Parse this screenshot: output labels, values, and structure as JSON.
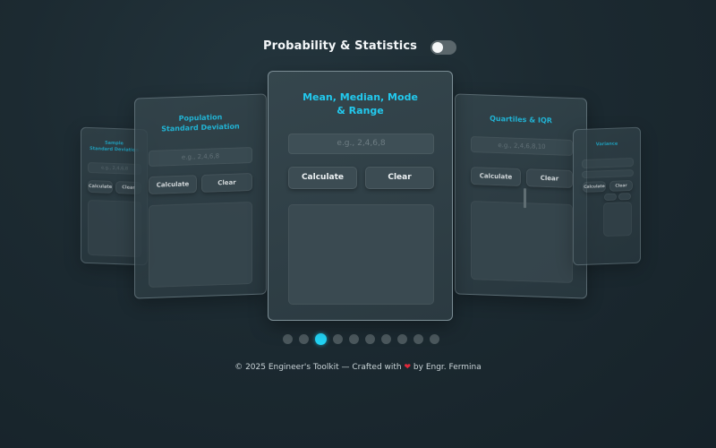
{
  "app_title": "Probability & Statistics",
  "theme_toggle": {
    "state": "off"
  },
  "cards": {
    "sample": {
      "title_line1": "Sample",
      "title_line2": "Standard Deviation",
      "placeholder": "e.g., 2,4,6,8",
      "calculate": "Calculate",
      "clear": "Clear"
    },
    "population": {
      "title_line1": "Population",
      "title_line2": "Standard Deviation",
      "placeholder": "e.g., 2,4,6,8",
      "calculate": "Calculate",
      "clear": "Clear"
    },
    "mean": {
      "title_line1": "Mean, Median, Mode",
      "title_line2": "& Range",
      "placeholder": "e.g., 2,4,6,8",
      "calculate": "Calculate",
      "clear": "Clear"
    },
    "quartiles": {
      "title": "Quartiles & IQR",
      "placeholder": "e.g., 2,4,6,8,10",
      "calculate": "Calculate",
      "clear": "Clear"
    },
    "variance": {
      "title": "Variance",
      "calculate": "Calculate",
      "clear": "Clear"
    }
  },
  "carousel": {
    "count": 10,
    "active_index": 2
  },
  "footer": {
    "before": "© 2025 Engineer's Toolkit — Crafted with",
    "heart": "❤",
    "after": "by Engr. Fermina"
  },
  "colors": {
    "accent": "#22c9ee",
    "background": "#1c2a31",
    "heart": "#e0283a"
  }
}
